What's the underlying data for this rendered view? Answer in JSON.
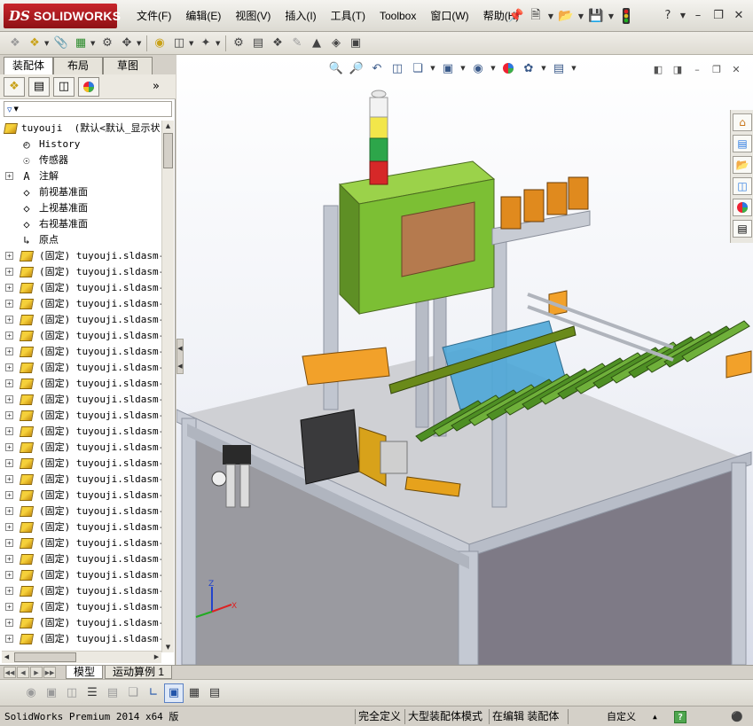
{
  "app": {
    "logo_prefix": "DS",
    "logo_name": "SOLIDWORKS"
  },
  "menu": {
    "items": [
      "文件(F)",
      "编辑(E)",
      "视图(V)",
      "插入(I)",
      "工具(T)",
      "Toolbox",
      "窗口(W)",
      "帮助(H)"
    ]
  },
  "feature_manager": {
    "tabs": [
      "装配体",
      "布局",
      "草图"
    ],
    "active_tab": "装配体",
    "root": {
      "name": "tuyouji",
      "config": "(默认<默认_显示状"
    },
    "fixed_items": [
      {
        "label": "History",
        "icon": "history-icon"
      },
      {
        "label": "传感器",
        "icon": "sensor-icon"
      },
      {
        "label": "注解",
        "icon": "annotation-icon",
        "expandable": true
      },
      {
        "label": "前视基准面",
        "icon": "plane-icon"
      },
      {
        "label": "上视基准面",
        "icon": "plane-icon"
      },
      {
        "label": "右视基准面",
        "icon": "plane-icon"
      },
      {
        "label": "原点",
        "icon": "origin-icon"
      }
    ],
    "component_label": "(固定) tuyouji.sldasm-P",
    "component_count": 25
  },
  "bottom_tabs": {
    "model": "模型",
    "motion": "运动算例 1"
  },
  "status_bar": {
    "product": "SolidWorks Premium 2014 x64 版",
    "definition": "完全定义",
    "mode": "大型装配体模式",
    "editing": "在编辑 装配体",
    "units": "自定义",
    "help_icon": "?"
  },
  "colors": {
    "logo_red": "#b81c22",
    "accent_blue": "#2255aa"
  }
}
